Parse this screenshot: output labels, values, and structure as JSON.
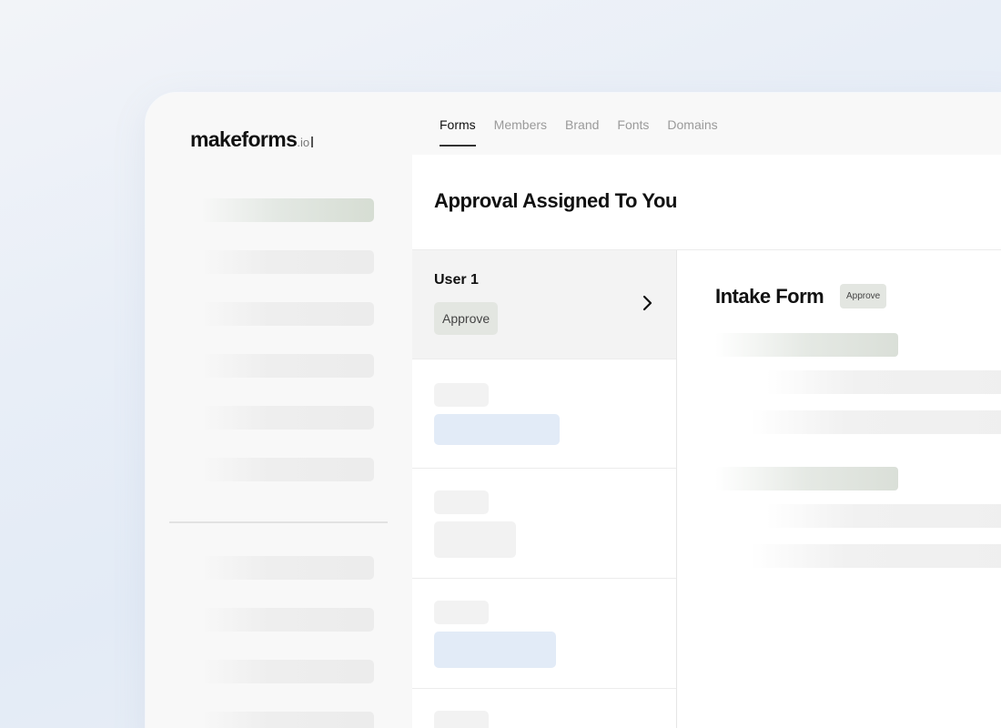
{
  "brand": {
    "name": "makeforms",
    "tld": ".io"
  },
  "nav": {
    "tabs": [
      {
        "label": "Forms",
        "active": true
      },
      {
        "label": "Members",
        "active": false
      },
      {
        "label": "Brand",
        "active": false
      },
      {
        "label": "Fonts",
        "active": false
      },
      {
        "label": "Domains",
        "active": false
      }
    ]
  },
  "page": {
    "title": "Approval Assigned To You"
  },
  "approvals": {
    "selected": {
      "user": "User 1",
      "status": "Approve"
    }
  },
  "detail": {
    "title": "Intake Form",
    "status": "Approve"
  },
  "colors": {
    "status_badge": "#e3e6e1",
    "placeholder_blue": "#e2ebf7",
    "active_tab_underline": "#333333"
  }
}
